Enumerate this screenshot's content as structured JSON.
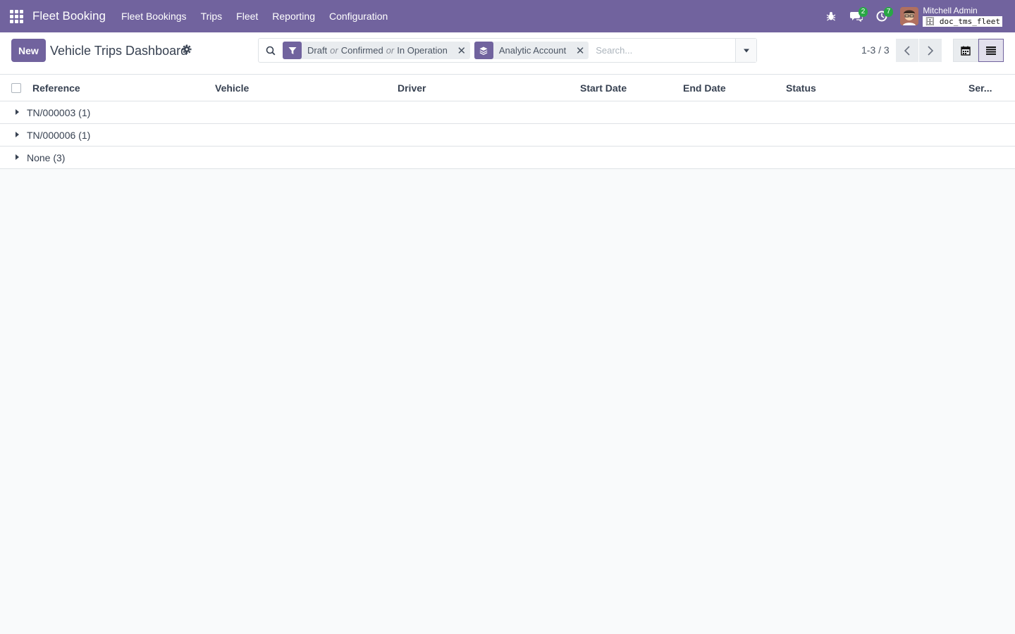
{
  "navbar": {
    "brand": "Fleet Booking",
    "menu": [
      "Fleet Bookings",
      "Trips",
      "Fleet",
      "Reporting",
      "Configuration"
    ],
    "messages_count": "2",
    "activities_count": "7",
    "user_name": "Mitchell Admin",
    "database": "doc_tms_fleet",
    "color": "#71639e"
  },
  "control": {
    "new_label": "New",
    "title": "Vehicle Trips Dashboard",
    "facets": [
      {
        "icon": "filter-icon",
        "values": [
          "Draft",
          "Confirmed",
          "In Operation"
        ],
        "separator": "or"
      },
      {
        "icon": "layers-icon",
        "values": [
          "Analytic Account"
        ]
      }
    ],
    "search_placeholder": "Search...",
    "pager": "1-3 / 3"
  },
  "table": {
    "columns": [
      "Reference",
      "Vehicle",
      "Driver",
      "Start Date",
      "End Date",
      "Status",
      "Ser..."
    ],
    "groups": [
      {
        "label": "TN/000003 (1)"
      },
      {
        "label": "TN/000006 (1)"
      },
      {
        "label": "None (3)"
      }
    ]
  }
}
